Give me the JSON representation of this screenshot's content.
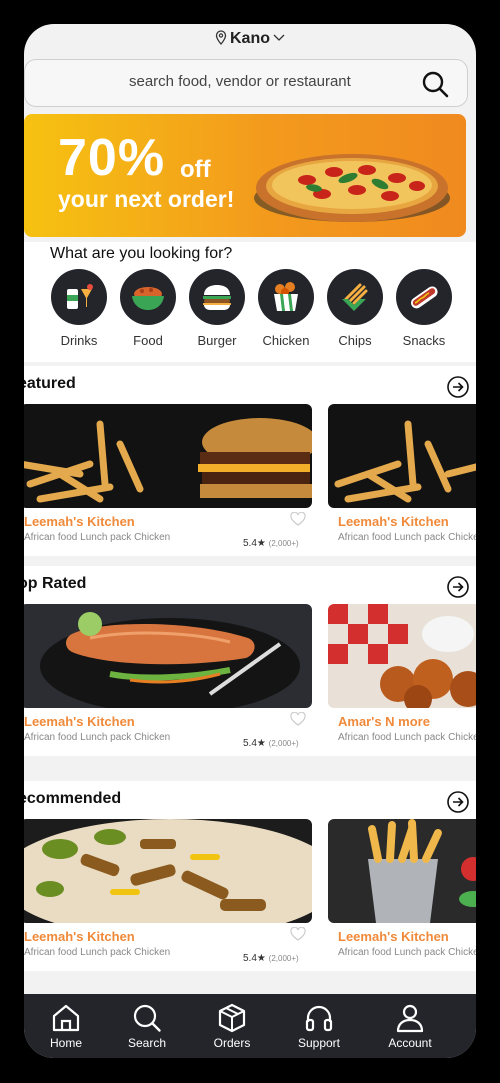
{
  "location": {
    "city": "Kano"
  },
  "search": {
    "placeholder": "search food, vendor or restaurant"
  },
  "banner": {
    "percent": "70%",
    "off": "off",
    "subtitle": "your next order!"
  },
  "categories": {
    "question": "What are you looking for?",
    "items": [
      {
        "label": "Drinks"
      },
      {
        "label": "Food"
      },
      {
        "label": "Burger"
      },
      {
        "label": "Chicken"
      },
      {
        "label": "Chips"
      },
      {
        "label": "Snacks"
      }
    ]
  },
  "sections": [
    {
      "title": "eatured",
      "cards": [
        {
          "name": "Leemah's Kitchen",
          "tags": "African food    Lunch pack    Chicken",
          "rating": "5.4",
          "count": "(2,000+)"
        },
        {
          "name": "Leemah's Kitchen",
          "tags": "African food    Lunch pack    Chicken"
        }
      ]
    },
    {
      "title": "op Rated",
      "cards": [
        {
          "name": "Leemah's Kitchen",
          "tags": "African food    Lunch pack    Chicken",
          "rating": "5.4",
          "count": "(2,000+)"
        },
        {
          "name": "Amar's N more",
          "tags": "African food    Lunch pack    Chicken"
        }
      ]
    },
    {
      "title": "ecommended",
      "cards": [
        {
          "name": "Leemah's Kitchen",
          "tags": "African food    Lunch pack    Chicken",
          "rating": "5.4",
          "count": "(2,000+)"
        },
        {
          "name": "Leemah's Kitchen",
          "tags": "African food    Lunch pack    Chicken"
        }
      ]
    }
  ],
  "nav": {
    "items": [
      {
        "label": "Home",
        "icon": "home-icon"
      },
      {
        "label": "Search",
        "icon": "search-icon"
      },
      {
        "label": "Orders",
        "icon": "box-icon"
      },
      {
        "label": "Support",
        "icon": "headphones-icon"
      },
      {
        "label": "Account",
        "icon": "user-icon"
      }
    ]
  },
  "colors": {
    "accent": "#f08a3a",
    "nav_bg": "#23252b",
    "banner_from": "#f6c211",
    "banner_to": "#f08a1f"
  }
}
